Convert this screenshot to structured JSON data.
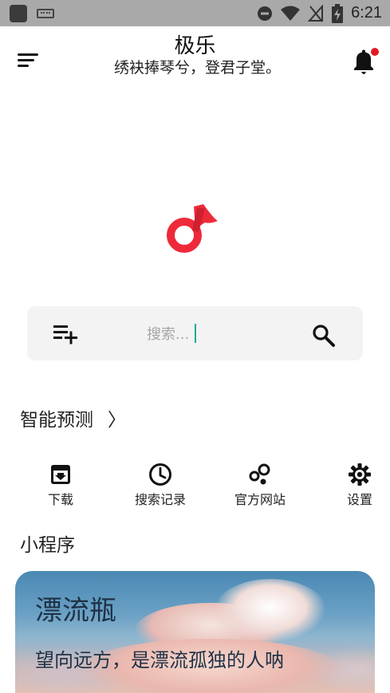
{
  "status_bar": {
    "time": "6:21",
    "icons": [
      "app-icon",
      "keyboard-icon",
      "do-not-disturb-icon",
      "wifi-icon",
      "no-signal-icon",
      "battery-charging-icon"
    ]
  },
  "header": {
    "title": "极乐",
    "subtitle": "绣袂捧琴兮，登君子堂。",
    "notification_dot_color": "#e31b23"
  },
  "logo": {
    "name": "music-note-logo",
    "color": "#ee2a3a"
  },
  "search": {
    "placeholder": "搜索...",
    "add_icon": "playlist-add-icon",
    "search_icon": "search-icon"
  },
  "prediction": {
    "label": "智能预测",
    "chevron": "〉"
  },
  "actions": [
    {
      "label": "下载",
      "icon": "download-box-icon"
    },
    {
      "label": "搜索记录",
      "icon": "history-clock-icon"
    },
    {
      "label": "官方网站",
      "icon": "bubbles-icon"
    },
    {
      "label": "设置",
      "icon": "gear-icon"
    }
  ],
  "mini_programs": {
    "section_title": "小程序",
    "card": {
      "title": "漂流瓶",
      "subtitle": "望向远方，是漂流孤独的人呐"
    }
  }
}
